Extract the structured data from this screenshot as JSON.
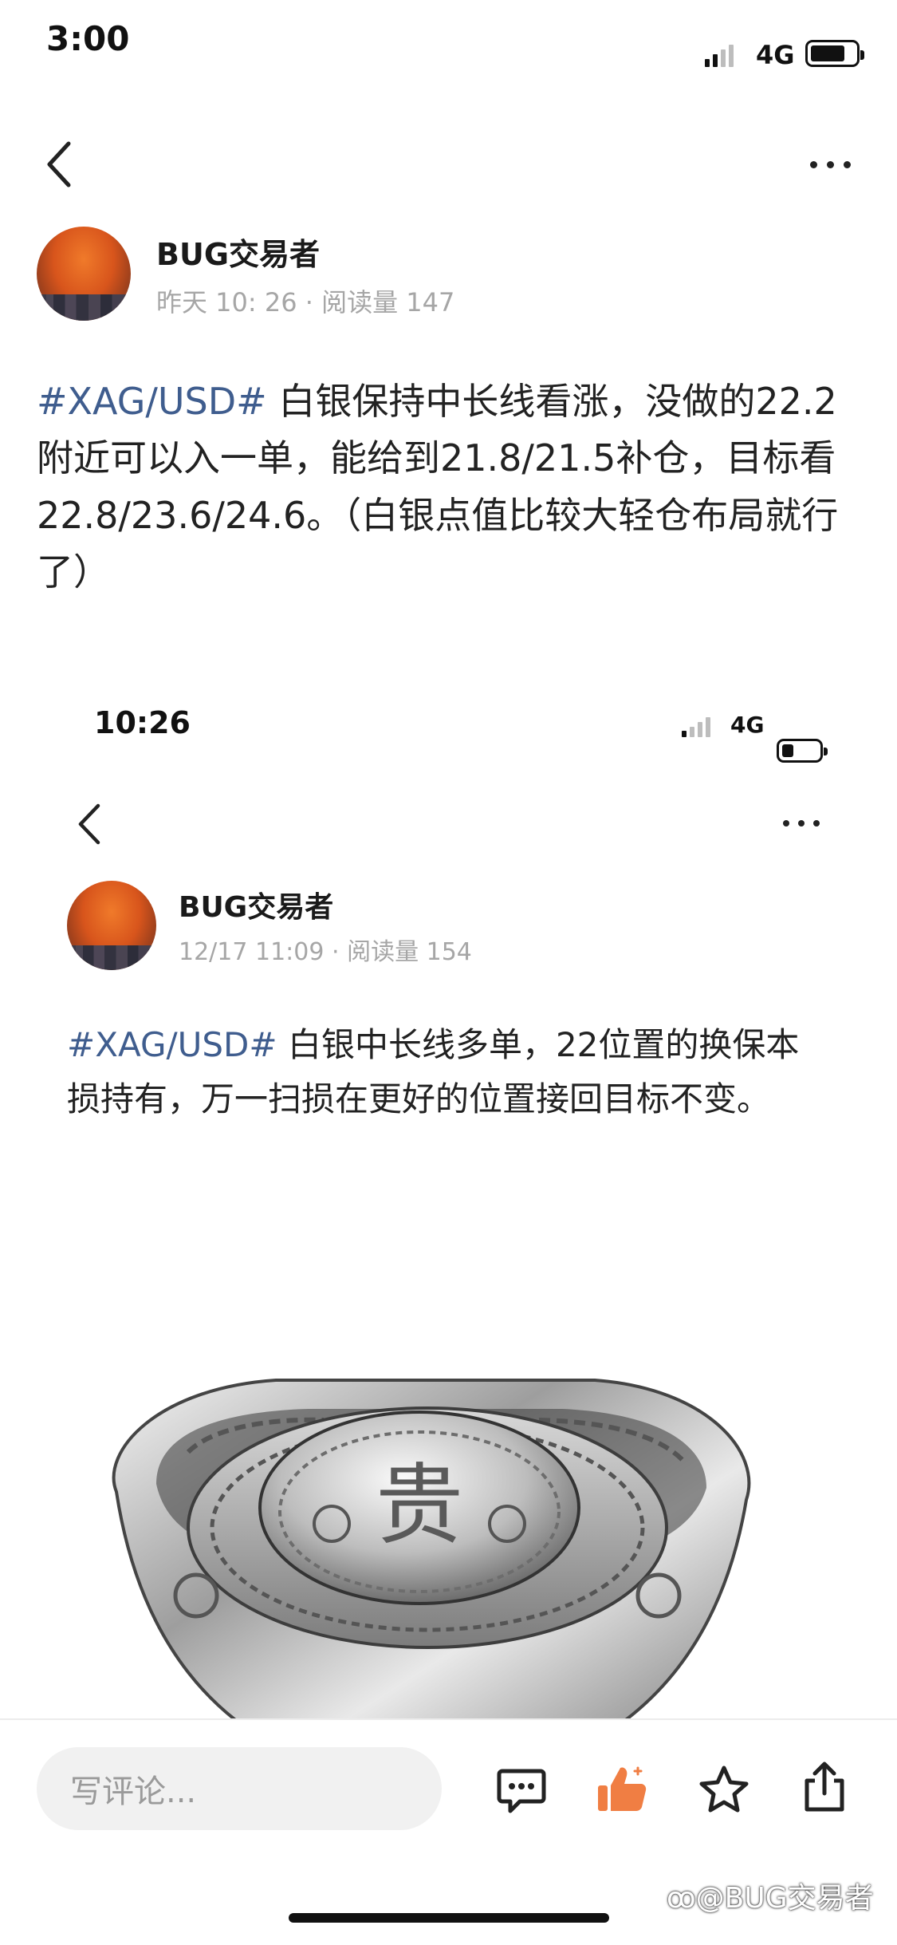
{
  "status_bar": {
    "time": "3:00",
    "network": "4G"
  },
  "post": {
    "author": "BUG交易者",
    "time": "昨天 10: 26",
    "reads": "阅读量 147",
    "tag": "#XAG/USD#",
    "body": " 白银保持中长线看涨，没做的22.2附近可以入一单，能给到21.8/21.5补仓，目标看22.8/23.6/24.6。（白银点值比较大轻仓布局就行了）"
  },
  "embedded": {
    "status_bar": {
      "time": "10:26",
      "network": "4G"
    },
    "author": "BUG交易者",
    "time": "12/17 11:09",
    "reads": "阅读量 154",
    "tag": "#XAG/USD#",
    "body": " 白银中长线多单，22位置的换保本损持有，万一扫损在更好的位置接回目标不变。",
    "image_glyph": "贵"
  },
  "bottom_bar": {
    "comment_placeholder": "写评论..."
  },
  "watermark": "@BUG交易者",
  "icons": [
    "back-icon",
    "more-icon",
    "signal-icon",
    "battery-icon",
    "comment-icon",
    "like-icon",
    "star-icon",
    "share-icon"
  ],
  "colors": {
    "tag": "#3f5d8e",
    "like": "#f07e43",
    "meta": "#a6a6a6"
  }
}
